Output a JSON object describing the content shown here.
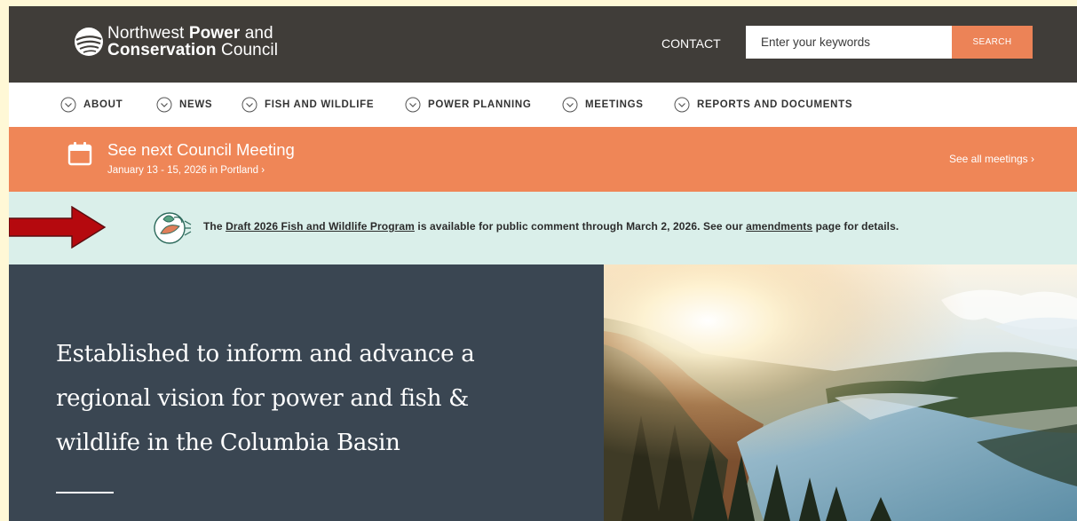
{
  "header": {
    "logo": {
      "line1_a": "Northwest ",
      "line1_b": "Power",
      "line1_c": " and",
      "line2_a": "Conservation",
      "line2_b": " Council"
    },
    "contact_label": "CONTACT",
    "search": {
      "placeholder": "Enter your keywords",
      "button_label": "SEARCH"
    }
  },
  "nav": {
    "items": [
      {
        "label": "ABOUT"
      },
      {
        "label": "NEWS"
      },
      {
        "label": "FISH AND WILDLIFE"
      },
      {
        "label": "POWER PLANNING"
      },
      {
        "label": "MEETINGS"
      },
      {
        "label": "REPORTS AND DOCUMENTS"
      }
    ]
  },
  "meeting": {
    "title": "See next Council Meeting",
    "subtitle": "January 13 - 15, 2026 in Portland ›",
    "see_all_label": "See all meetings ›"
  },
  "notice": {
    "prefix": "The ",
    "program_link": "Draft 2026 Fish and Wildlife Program",
    "middle": " is available for public comment through March 2, 2026. See our ",
    "amendments_link": "amendments",
    "suffix": " page for details."
  },
  "hero": {
    "heading": "Established to inform and advance a regional vision for power and fish & wildlife in the Columbia Basin"
  },
  "colors": {
    "header_bg": "#403d39",
    "accent_orange": "#ef8657",
    "notice_bg": "#daefea",
    "hero_bg": "#3a4652",
    "arrow_red": "#b5090e"
  }
}
